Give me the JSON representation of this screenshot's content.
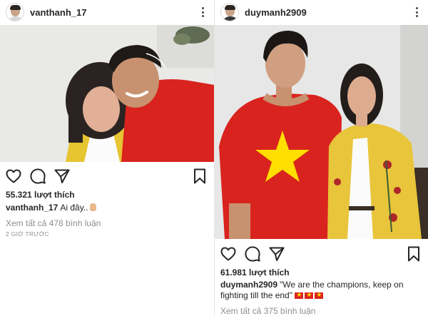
{
  "posts": [
    {
      "username": "vanthanh_17",
      "likes": "55.321 lượt thích",
      "caption_user": "vanthanh_17",
      "caption_text": "Ai đây..",
      "caption_emoji": "hand-emoji",
      "view_comments": "Xem tất cả 478 bình luận",
      "timestamp": "2 GIỜ TRƯỚC"
    },
    {
      "username": "duymanh2909",
      "likes": "61.981 lượt thích",
      "caption_user": "duymanh2909",
      "caption_text": "\"We are the champions, keep on fighting till the end\"",
      "caption_emoji": "vietnam-flag-emoji x3",
      "view_comments": "Xem tất cả 375 bình luận"
    }
  ],
  "icons": [
    "more-options-icon",
    "heart-icon",
    "comment-icon",
    "share-icon",
    "bookmark-icon"
  ],
  "colors": {
    "text": "#262626",
    "muted": "#8e8e8e",
    "shirt_red": "#d9231e",
    "star_yellow": "#ffde00",
    "jacket_yellow": "#e8c53a"
  }
}
